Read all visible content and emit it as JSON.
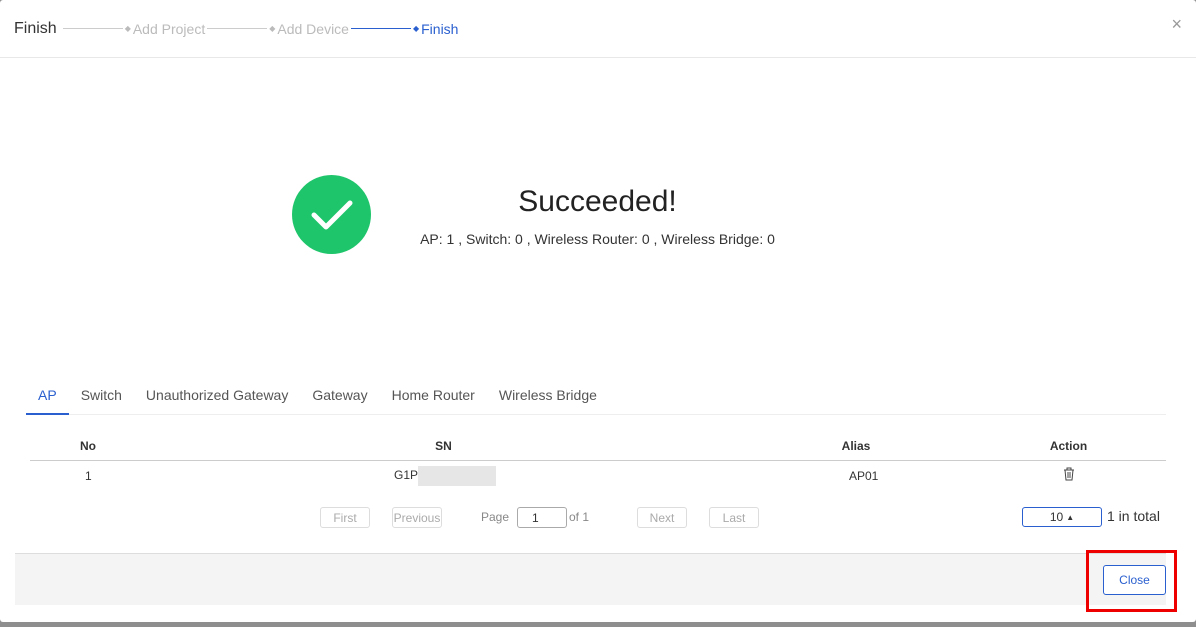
{
  "header": {
    "title": "Finish",
    "steps": [
      {
        "label": "Add Project",
        "active": false
      },
      {
        "label": "Add Device",
        "active": false
      },
      {
        "label": "Finish",
        "active": true
      }
    ],
    "close_icon": "×"
  },
  "result": {
    "icon": "check-circle-icon",
    "color": "#1fc56b",
    "title": "Succeeded!",
    "summary": "AP: 1 , Switch: 0 , Wireless Router: 0 , Wireless Bridge: 0"
  },
  "tabs": [
    {
      "label": "AP",
      "active": true
    },
    {
      "label": "Switch"
    },
    {
      "label": "Unauthorized Gateway"
    },
    {
      "label": "Gateway"
    },
    {
      "label": "Home Router"
    },
    {
      "label": "Wireless Bridge"
    }
  ],
  "table": {
    "columns": [
      "No",
      "SN",
      "Alias",
      "Action"
    ],
    "rows": [
      {
        "no": "1",
        "sn": "G1P",
        "alias": "AP01",
        "action": "trash-icon"
      }
    ]
  },
  "pager": {
    "first": "First",
    "previous": "Previous",
    "page_label": "Page",
    "page_value": "1",
    "of": "of 1",
    "next": "Next",
    "last": "Last",
    "page_size": "10",
    "total": "1 in total"
  },
  "footer": {
    "close": "Close"
  },
  "accent": "#2a5fcf"
}
